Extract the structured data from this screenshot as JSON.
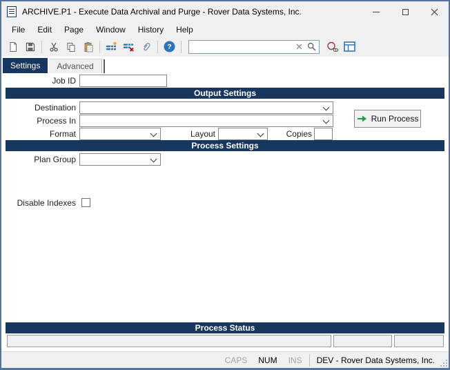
{
  "window": {
    "title": "ARCHIVE.P1 - Execute Data Archival and Purge - Rover Data Systems, Inc."
  },
  "menu": {
    "items": [
      "File",
      "Edit",
      "Page",
      "Window",
      "History",
      "Help"
    ]
  },
  "toolbar": {
    "search_value": "",
    "search_placeholder": ""
  },
  "tabs": {
    "settings": "Settings",
    "advanced": "Advanced"
  },
  "sections": {
    "output": "Output Settings",
    "process": "Process Settings",
    "status": "Process Status"
  },
  "fields": {
    "job_id_label": "Job ID",
    "job_id_value": "",
    "destination_label": "Destination",
    "destination_value": "",
    "process_in_label": "Process In",
    "process_in_value": "",
    "format_label": "Format",
    "format_value": "",
    "layout_label": "Layout",
    "layout_value": "",
    "copies_label": "Copies",
    "copies_value": "",
    "plan_group_label": "Plan Group",
    "plan_group_value": "",
    "disable_indexes_label": "Disable Indexes"
  },
  "buttons": {
    "run_process": "Run Process"
  },
  "status_fields": {
    "field1": "",
    "field2": "",
    "field3": ""
  },
  "statusbar": {
    "caps": "CAPS",
    "num": "NUM",
    "ins": "INS",
    "environment": "DEV - Rover Data Systems, Inc."
  },
  "colors": {
    "accent_navy": "#17375e",
    "frame_blue": "#54749e",
    "toolbar_blue": "#2e75b6",
    "run_green": "#1e9e3e"
  }
}
